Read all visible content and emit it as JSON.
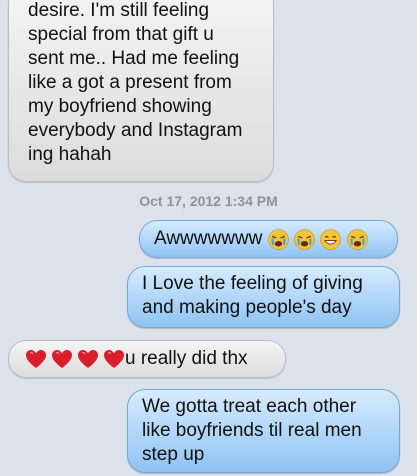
{
  "messages": [
    {
      "from": "them",
      "lines": [
        "desire. I'm still feeling",
        "special from that gift u",
        "sent me.. Had me feeling",
        "like a got a present from",
        "my boyfriend showing",
        "everybody and Instagram",
        "ing hahah"
      ]
    },
    {
      "from": "me",
      "text": "Awwwwwww",
      "emoji": [
        "crying-face",
        "crying-face",
        "grinning-face",
        "crying-face"
      ]
    },
    {
      "from": "me",
      "lines": [
        "I Love the feeling of giving",
        "and making people's day"
      ]
    },
    {
      "from": "them",
      "prefix_emoji": [
        "red-heart",
        "red-heart",
        "red-heart",
        "red-heart"
      ],
      "text": "u really did thx"
    },
    {
      "from": "me",
      "lines": [
        "We gotta treat each other",
        "like boyfriends til real men",
        "step up"
      ]
    }
  ],
  "timestamp": "Oct 17, 2012 1:34 PM",
  "colors": {
    "background": "#dbe2ec",
    "received": "#e8e8e8",
    "sent": "#b3d8f8",
    "heart": "#d81e2a",
    "emoji": "#f6c33c"
  }
}
